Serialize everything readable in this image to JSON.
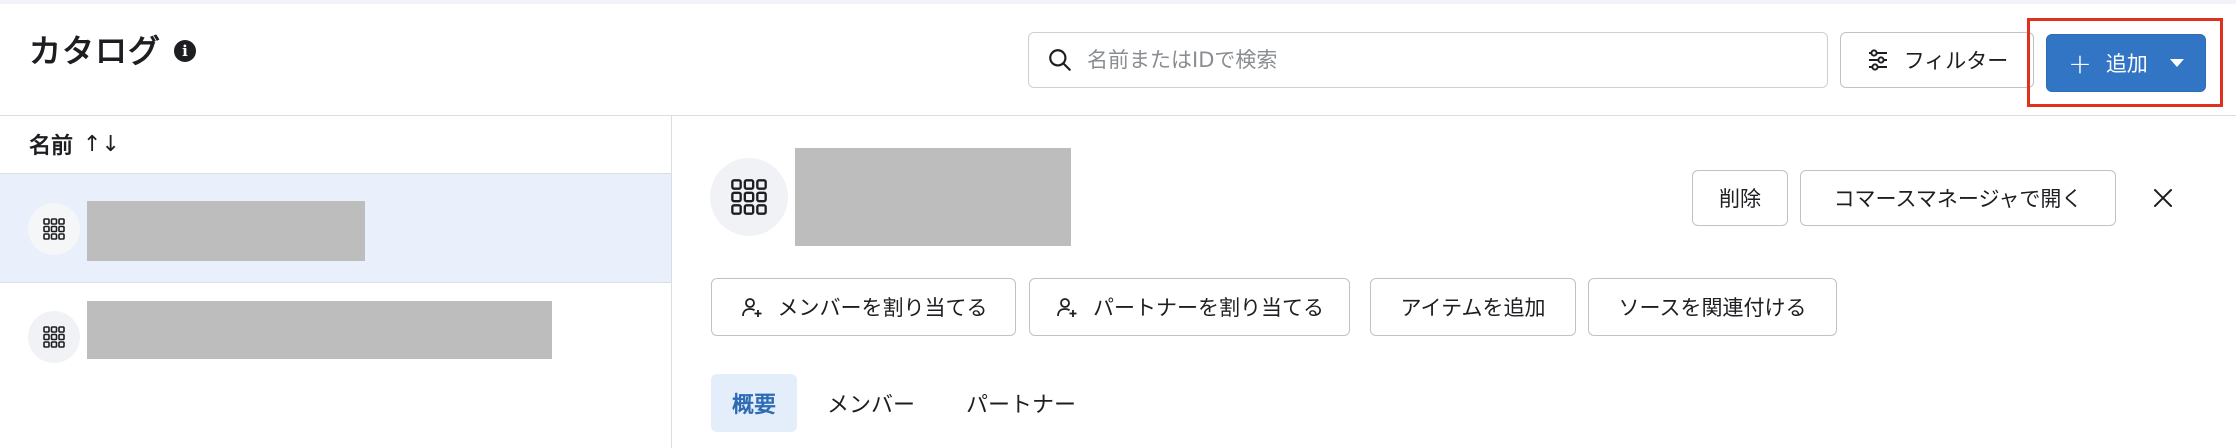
{
  "header": {
    "title": "カタログ",
    "info_icon": "info-icon",
    "search": {
      "placeholder": "名前またはIDで検索",
      "value": "",
      "icon": "search-icon"
    },
    "filter_label": "フィルター",
    "add_label": "追加"
  },
  "list": {
    "column_label": "名前",
    "sort_glyph": "↑↓",
    "rows": [
      {
        "icon": "grid-icon",
        "selected": true
      },
      {
        "icon": "grid-icon",
        "selected": false
      }
    ]
  },
  "detail": {
    "icon": "grid-icon",
    "delete_label": "削除",
    "open_label": "コマースマネージャで開く",
    "close_glyph": "✕",
    "actions": {
      "assign_member": "メンバーを割り当てる",
      "assign_partner": "パートナーを割り当てる",
      "add_item": "アイテムを追加",
      "link_source": "ソースを関連付ける"
    },
    "tabs": [
      {
        "label": "概要",
        "active": true
      },
      {
        "label": "メンバー",
        "active": false
      },
      {
        "label": "パートナー",
        "active": false
      }
    ]
  },
  "colors": {
    "primary": "#3275c4",
    "highlight": "#e0311e",
    "selected_row": "#e9f0fb",
    "active_tab_bg": "#e4eefa",
    "redaction": "#bdbdbd"
  }
}
